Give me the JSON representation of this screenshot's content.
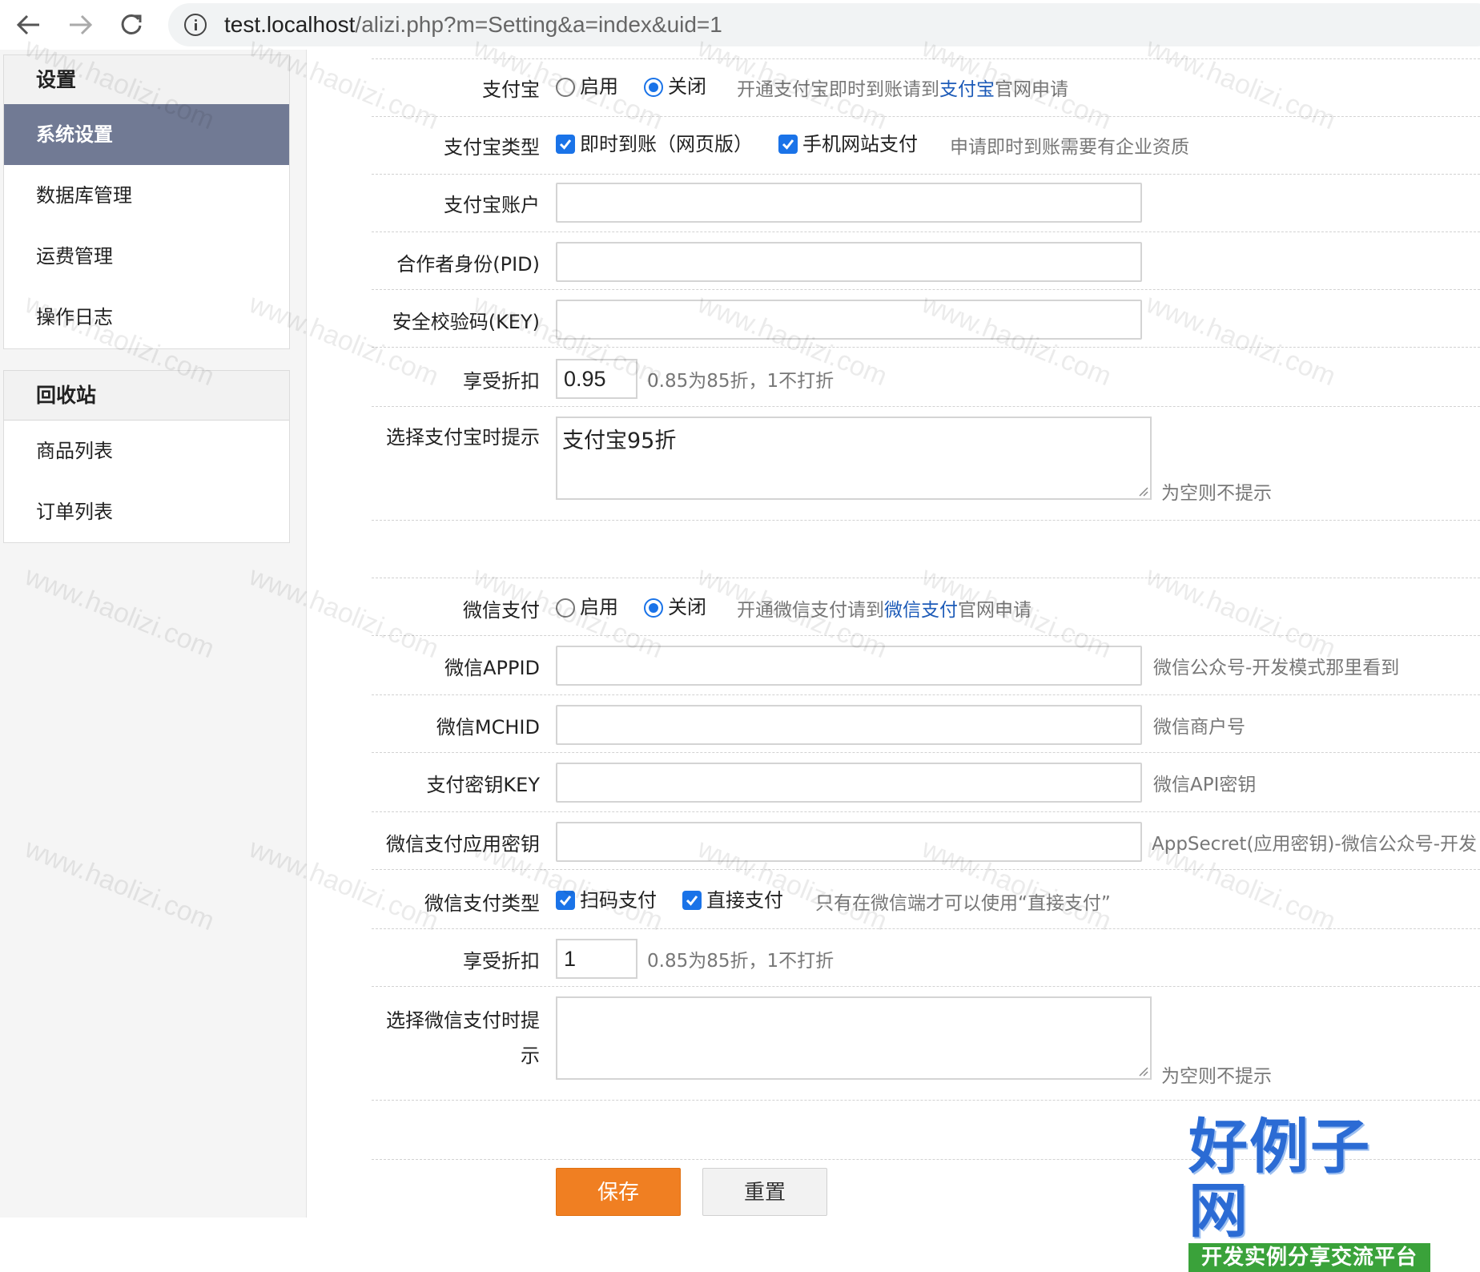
{
  "browser": {
    "url_host": "test.localhost",
    "url_path": "/alizi.php?m=Setting&a=index&uid=1"
  },
  "sidebar": {
    "panels": [
      {
        "title": "设置",
        "items": [
          {
            "label": "系统设置",
            "active": true
          },
          {
            "label": "数据库管理"
          },
          {
            "label": "运费管理"
          },
          {
            "label": "操作日志"
          }
        ]
      },
      {
        "title": "回收站",
        "items": [
          {
            "label": "商品列表"
          },
          {
            "label": "订单列表"
          }
        ]
      }
    ]
  },
  "form": {
    "alipay": {
      "label": "支付宝",
      "enable": "启用",
      "disable": "关闭",
      "hint_prefix": "开通支付宝即时到账请到",
      "hint_link": "支付宝",
      "hint_suffix": "官网申请",
      "selected": "disable"
    },
    "alipay_type": {
      "label": "支付宝类型",
      "opt1": "即时到账（网页版）",
      "opt2": "手机网站支付",
      "hint": "申请即时到账需要有企业资质"
    },
    "alipay_account": {
      "label": "支付宝账户",
      "value": ""
    },
    "alipay_pid": {
      "label": "合作者身份(PID)",
      "value": ""
    },
    "alipay_key": {
      "label": "安全校验码(KEY)",
      "value": ""
    },
    "alipay_discount": {
      "label": "享受折扣",
      "value": "0.95",
      "hint": "0.85为85折，1不打折"
    },
    "alipay_tip": {
      "label": "选择支付宝时提示",
      "value": "支付宝95折",
      "hint": "为空则不提示"
    },
    "wxpay": {
      "label": "微信支付",
      "enable": "启用",
      "disable": "关闭",
      "hint_prefix": "开通微信支付请到",
      "hint_link": "微信支付",
      "hint_suffix": "官网申请",
      "selected": "disable"
    },
    "wx_appid": {
      "label": "微信APPID",
      "value": "",
      "hint": "微信公众号-开发模式那里看到"
    },
    "wx_mchid": {
      "label": "微信MCHID",
      "value": "",
      "hint": "微信商户号"
    },
    "wx_key": {
      "label": "支付密钥KEY",
      "value": "",
      "hint": "微信API密钥"
    },
    "wx_secret": {
      "label": "微信支付应用密钥",
      "value": "",
      "hint": "AppSecret(应用密钥)-微信公众号-开发"
    },
    "wx_type": {
      "label": "微信支付类型",
      "opt1": "扫码支付",
      "opt2": "直接支付",
      "hint": "只有在微信端才可以使用“直接支付”"
    },
    "wx_discount": {
      "label": "享受折扣",
      "value": "1",
      "hint": "0.85为85折，1不打折"
    },
    "wx_tip": {
      "label": "选择微信支付时提示",
      "value": "",
      "hint": "为空则不提示"
    },
    "save_label": "保存",
    "reset_label": "重置"
  },
  "watermark": "www.haolizi.com",
  "brand": {
    "main": "好例子网",
    "sub": "开发实例分享交流平台"
  },
  "colors": {
    "accent": "#1a73e8",
    "active_nav": "#717a94",
    "save_button": "#f07f22",
    "link": "#1d5bb8"
  }
}
